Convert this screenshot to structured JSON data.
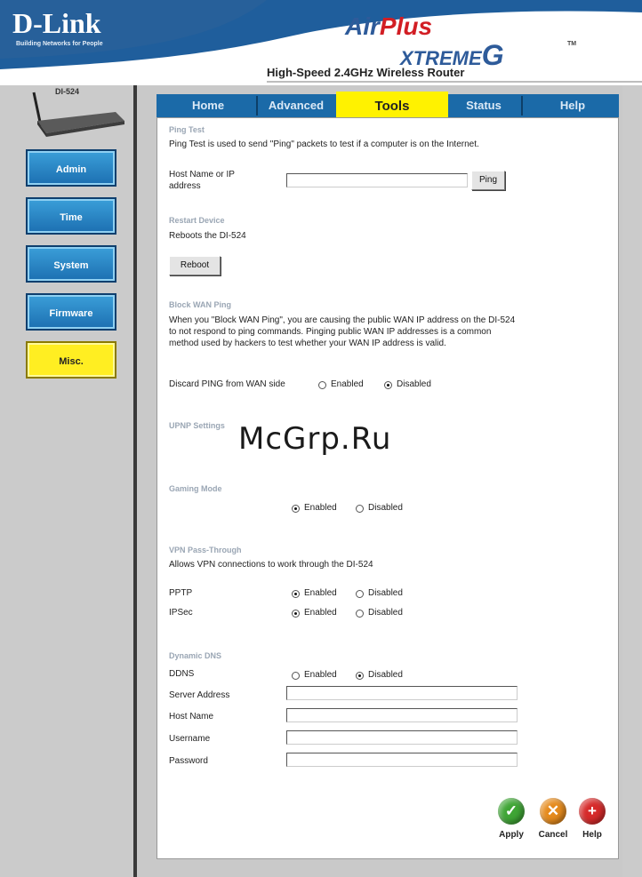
{
  "header": {
    "brand": "D-Link",
    "brand_tagline": "Building Networks for People",
    "product_air": "Air",
    "product_plus": "Plus",
    "product_xtreme": "XTREME",
    "product_g": "G",
    "product_tm": "TM",
    "subtitle": "High-Speed 2.4GHz Wireless Router"
  },
  "sidebar": {
    "model": "DI-524",
    "items": [
      {
        "label": "Admin",
        "active": false
      },
      {
        "label": "Time",
        "active": false
      },
      {
        "label": "System",
        "active": false
      },
      {
        "label": "Firmware",
        "active": false
      },
      {
        "label": "Misc.",
        "active": true
      }
    ]
  },
  "tabs": [
    {
      "label": "Home",
      "active": false
    },
    {
      "label": "Advanced",
      "active": false
    },
    {
      "label": "Tools",
      "active": true
    },
    {
      "label": "Status",
      "active": false
    },
    {
      "label": "Help",
      "active": false
    }
  ],
  "ping_test": {
    "title": "Ping Test",
    "description": "Ping Test is used to send \"Ping\" packets to test if a computer is on the Internet.",
    "host_label_line1": "Host Name or IP",
    "host_label_line2": "address",
    "host_value": "",
    "ping_button": "Ping"
  },
  "restart": {
    "title": "Restart Device",
    "description": "Reboots the DI-524",
    "reboot_button": "Reboot"
  },
  "block_wan": {
    "title": "Block WAN Ping",
    "description_lines": [
      "When you \"Block WAN Ping\", you are causing the public WAN IP address on the DI-524",
      "to not respond to ping commands. Pinging public WAN IP addresses is a common",
      "method used by hackers to test whether your WAN IP address is valid."
    ],
    "discard_label": "Discard PING from WAN side",
    "enabled": "Enabled",
    "disabled": "Disabled",
    "selected": "disabled"
  },
  "upnp": {
    "title": "UPNP Settings"
  },
  "gaming": {
    "title": "Gaming Mode",
    "enabled": "Enabled",
    "disabled": "Disabled",
    "selected": "enabled"
  },
  "vpn": {
    "title": "VPN Pass-Through",
    "description": "Allows VPN connections to work through the DI-524",
    "pptp_label": "PPTP",
    "ipsec_label": "IPSec",
    "enabled": "Enabled",
    "disabled": "Disabled",
    "pptp_selected": "enabled",
    "ipsec_selected": "enabled"
  },
  "ddns": {
    "title": "Dynamic DNS",
    "ddns_label": "DDNS",
    "enabled": "Enabled",
    "disabled": "Disabled",
    "selected": "disabled",
    "server_label": "Server Address",
    "host_label": "Host Name",
    "username_label": "Username",
    "password_label": "Password",
    "server_value": "",
    "host_value": "",
    "username_value": "",
    "password_value": ""
  },
  "actions": {
    "apply": "Apply",
    "cancel": "Cancel",
    "help": "Help",
    "apply_color": "#3fa535",
    "cancel_color": "#e58a1c",
    "help_color": "#d62a2a"
  },
  "watermark": "McGrp.Ru"
}
